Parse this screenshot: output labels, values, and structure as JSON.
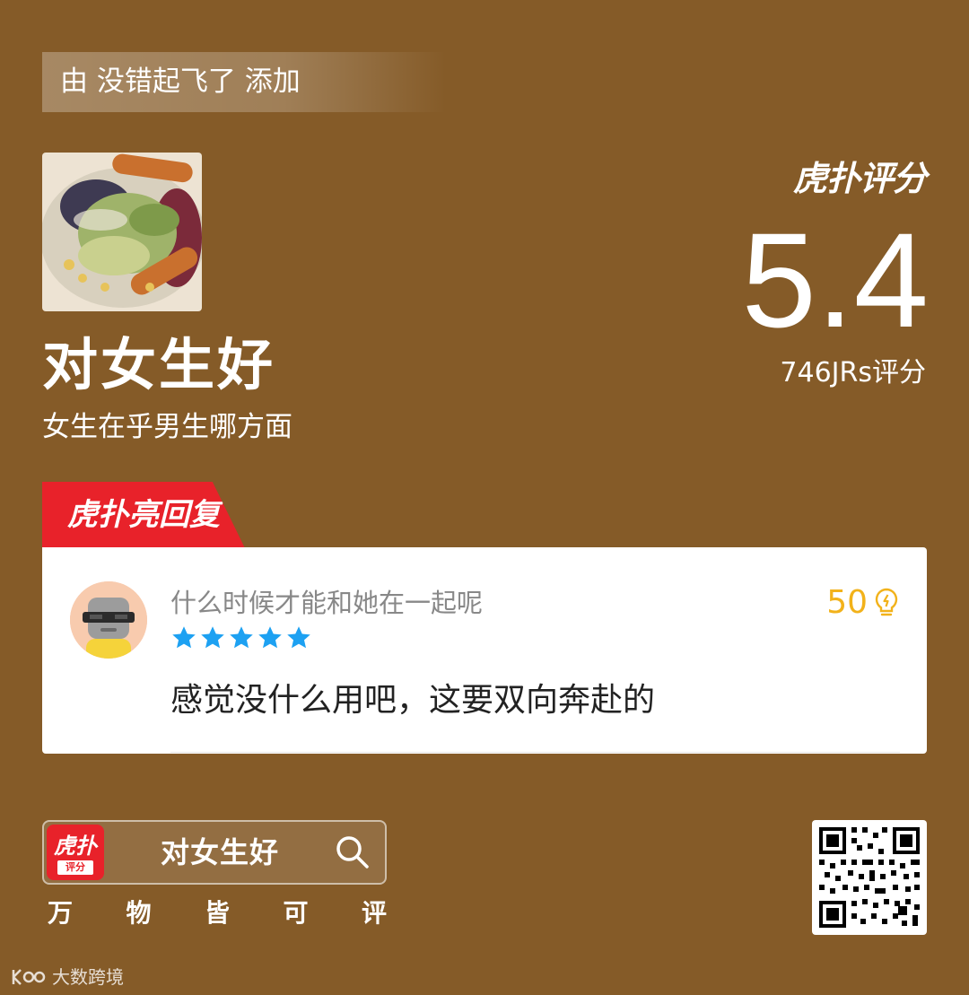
{
  "header": {
    "added_by": "由 没错起飞了 添加"
  },
  "item": {
    "title": "对女生好",
    "subtitle": "女生在乎男生哪方面",
    "thumbnail_alt": "salad-photo"
  },
  "rating": {
    "brand_label": "虎扑评分",
    "score": "5.4",
    "count_label": "746JRs评分"
  },
  "hot_reply": {
    "tag_label": "虎扑亮回复",
    "username": "什么时候才能和她在一起呢",
    "stars": 5,
    "likes": "50",
    "comment": "感觉没什么用吧，这要双向奔赴的"
  },
  "footer": {
    "app_icon_label": "虎扑",
    "app_icon_sub": "评分",
    "search_text": "对女生好",
    "slogan": [
      "万",
      "物",
      "皆",
      "可",
      "评"
    ],
    "watermark": "大数跨境"
  },
  "colors": {
    "background": "#855B28",
    "accent_red": "#E8222A",
    "star_blue": "#1DA1F2",
    "likes_gold": "#F2B21A"
  }
}
